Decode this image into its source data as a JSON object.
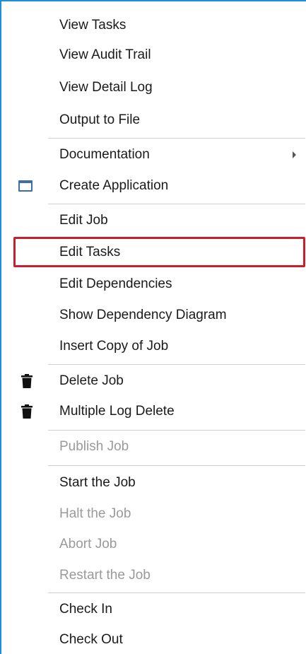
{
  "menu": {
    "view_tasks": "View Tasks",
    "view_audit_trail": "View Audit Trail",
    "view_detail_log": "View Detail Log",
    "output_to_file": "Output to File",
    "documentation": "Documentation",
    "create_application": "Create Application",
    "edit_job": "Edit Job",
    "edit_tasks": "Edit Tasks",
    "edit_dependencies": "Edit Dependencies",
    "show_dependency_diagram": "Show Dependency Diagram",
    "insert_copy_of_job": "Insert Copy of Job",
    "delete_job": "Delete Job",
    "multiple_log_delete": "Multiple Log Delete",
    "publish_job": "Publish Job",
    "start_the_job": "Start the Job",
    "halt_the_job": "Halt the Job",
    "abort_job": "Abort Job",
    "restart_the_job": "Restart the Job",
    "check_in": "Check In",
    "check_out": "Check Out"
  },
  "icons": {
    "create_application": "window-icon",
    "delete_job": "trash-icon",
    "multiple_log_delete": "trash-icon",
    "documentation_submenu": "chevron-right-icon"
  },
  "colors": {
    "accent_border": "#1e90d8",
    "highlight_outline": "#c5202e",
    "disabled_text": "#9a9a9a"
  }
}
